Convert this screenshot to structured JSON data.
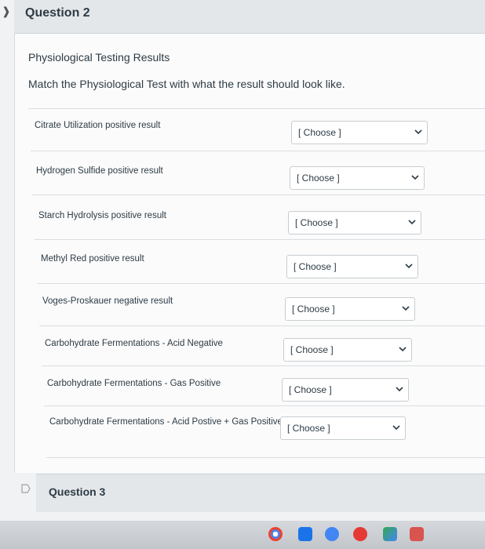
{
  "question2": {
    "title": "Question 2"
  },
  "section_title": "Physiological Testing Results",
  "instruction": "Match the Physiological Test with what the result should look like.",
  "rows": [
    {
      "label": "Citrate Utilization positive result",
      "selected": "[ Choose ]"
    },
    {
      "label": "Hydrogen Sulfide positive result",
      "selected": "[ Choose ]"
    },
    {
      "label": "Starch Hydrolysis positive result",
      "selected": "[ Choose ]"
    },
    {
      "label": "Methyl Red positive result",
      "selected": "[ Choose ]"
    },
    {
      "label": "Voges-Proskauer negative result",
      "selected": "[ Choose ]"
    },
    {
      "label": "Carbohydrate Fermentations - Acid Negative",
      "selected": "[ Choose ]"
    },
    {
      "label": "Carbohydrate Fermentations - Gas Positive",
      "selected": "[ Choose ]"
    },
    {
      "label": "Carbohydrate Fermentations - Acid Postive + Gas Positive",
      "selected": "[ Choose ]"
    }
  ],
  "question3": {
    "title": "Question 3"
  },
  "colors": {
    "header_bg": "#e4e7ea",
    "text": "#2d3b45",
    "select_border": "#c7cdd1"
  },
  "dock_icons": [
    "chrome-icon",
    "files-icon",
    "docs-icon",
    "youtube-icon",
    "play-store-icon",
    "photos-icon"
  ]
}
